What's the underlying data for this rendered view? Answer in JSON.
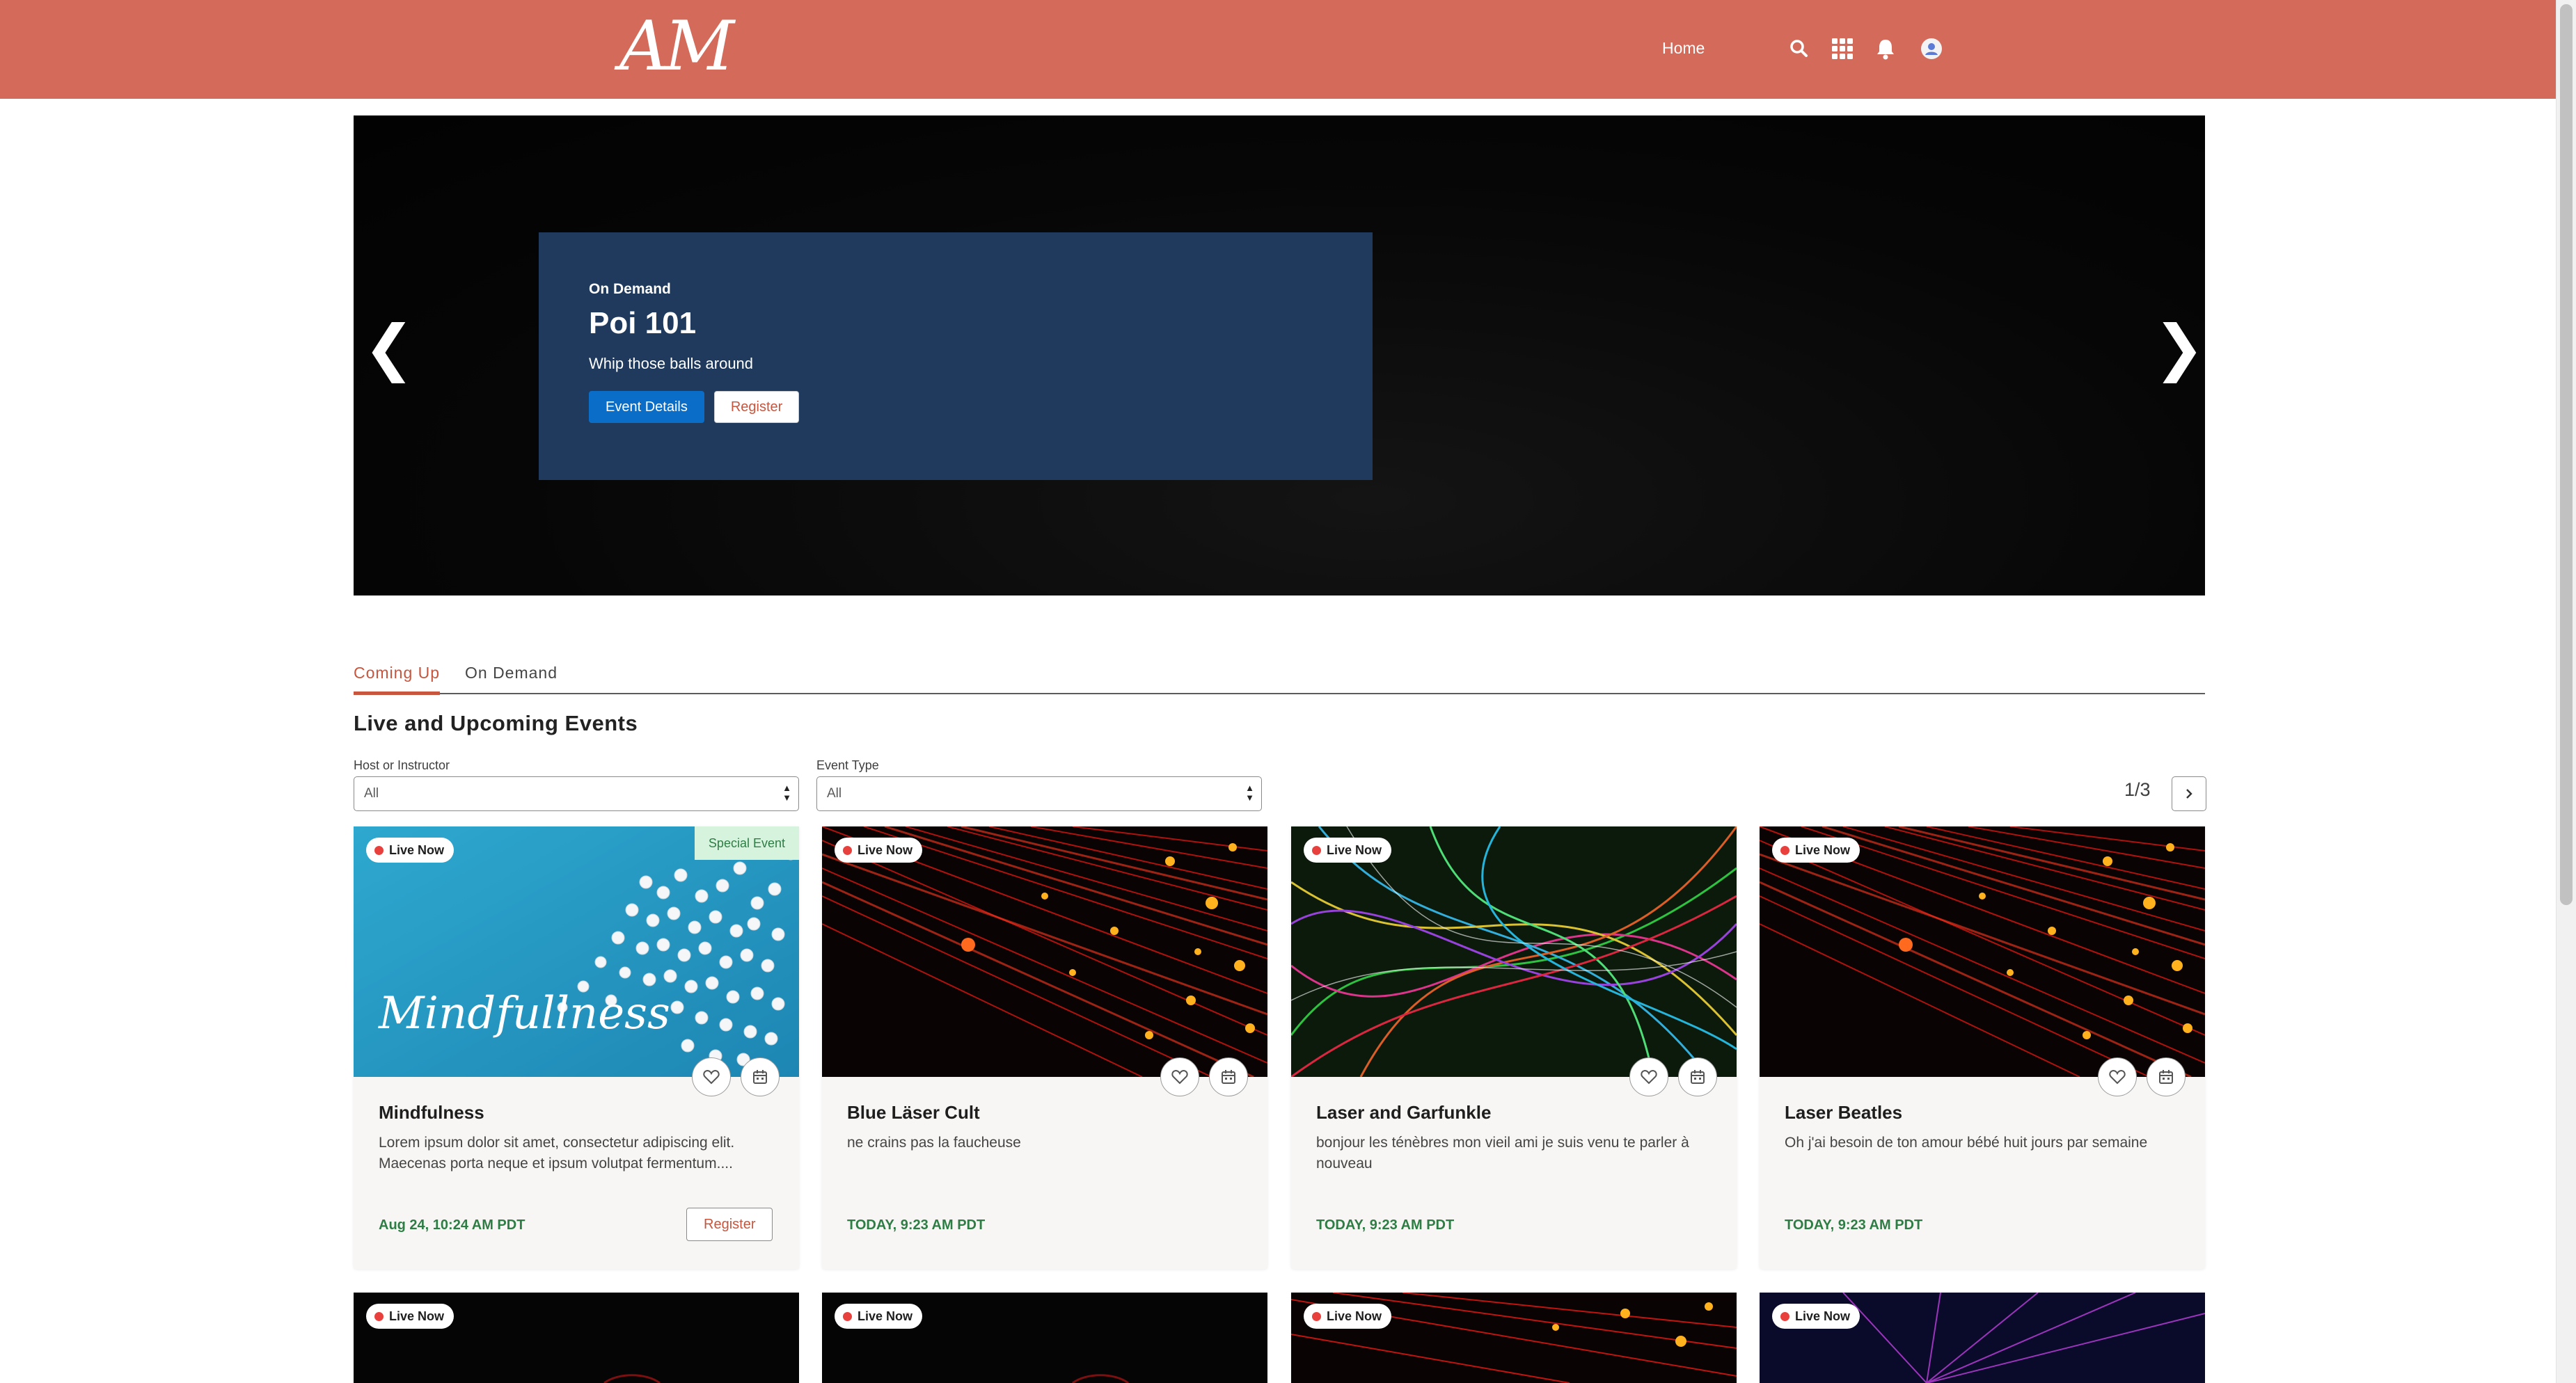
{
  "header": {
    "logo_text": "AM",
    "nav_home": "Home",
    "icons": [
      "search-icon",
      "app-launcher-icon",
      "notifications-bell-icon",
      "user-avatar-icon"
    ],
    "color": "#d46b5a"
  },
  "hero": {
    "eyebrow": "On Demand",
    "title": "Poi 101",
    "subtitle": "Whip those balls around",
    "primary_button": "Event Details",
    "secondary_button": "Register",
    "prev_arrow": "❮",
    "next_arrow": "❯"
  },
  "tabs": [
    {
      "label": "Coming Up",
      "active": true
    },
    {
      "label": "On Demand",
      "active": false
    }
  ],
  "section_title": "Live and Upcoming Events",
  "filters": {
    "host": {
      "label": "Host or Instructor",
      "value": "All"
    },
    "event_type": {
      "label": "Event Type",
      "value": "All"
    }
  },
  "pager": {
    "text": "1/3"
  },
  "cards": [
    {
      "badge": "Live Now",
      "special": "Special Event",
      "image_text": "Mindfullness",
      "title": "Mindfulness",
      "description": "Lorem ipsum dolor sit amet, consectetur adipiscing elit. Maecenas porta neque et ipsum volutpat fermentum....",
      "date": "Aug 24, 10:24 AM PDT",
      "register": "Register"
    },
    {
      "badge": "Live Now",
      "title": "Blue Läser Cult",
      "description": "ne crains pas la faucheuse",
      "date": "TODAY, 9:23 AM PDT"
    },
    {
      "badge": "Live Now",
      "title": "Laser and Garfunkle",
      "description": "bonjour les ténèbres mon vieil ami je suis venu te parler à nouveau",
      "date": "TODAY, 9:23 AM PDT"
    },
    {
      "badge": "Live Now",
      "title": "Laser Beatles",
      "description": "Oh j'ai besoin de ton amour bébé huit jours par semaine",
      "date": "TODAY, 9:23 AM PDT"
    }
  ],
  "second_row_badges": [
    "Live Now",
    "Live Now",
    "Live Now",
    "Live Now"
  ]
}
